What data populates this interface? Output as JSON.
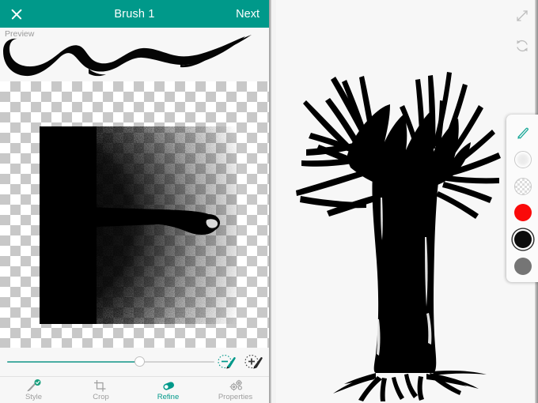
{
  "app": {
    "accent_color": "#00998a",
    "accent_light": "#4aada3"
  },
  "header": {
    "title": "Brush 1",
    "close_icon": "close-icon",
    "next_label": "Next"
  },
  "preview": {
    "label": "Preview",
    "stroke_color": "#000000"
  },
  "editor": {
    "canvas_background": "checkerboard",
    "bitmap_description": "dithered brush tip stamp"
  },
  "slider": {
    "value_percent": 64,
    "fill_color": "#4aada3",
    "track_color": "#d2d2d2"
  },
  "brush_tools": [
    {
      "name": "erase-brush-tool",
      "icon": "brush-minus-icon",
      "color": "#00998a",
      "selected": true
    },
    {
      "name": "add-brush-tool",
      "icon": "brush-plus-icon",
      "color": "#2b2b2b",
      "selected": false
    }
  ],
  "bottom_nav": {
    "items": [
      {
        "label": "Style",
        "icon": "brush-style-icon",
        "active": false
      },
      {
        "label": "Crop",
        "icon": "crop-icon",
        "active": false
      },
      {
        "label": "Refine",
        "icon": "refine-capsule-icon",
        "active": true
      },
      {
        "label": "Properties",
        "icon": "gears-icon",
        "active": false
      }
    ]
  },
  "canvas": {
    "background_color": "#f5f5f5",
    "artwork_title": "tree silhouette",
    "artwork_color": "#000000",
    "tools": [
      {
        "name": "expand-canvas-button",
        "icon": "expand-arrows-icon"
      },
      {
        "name": "reset-canvas-button",
        "icon": "refresh-icon"
      }
    ]
  },
  "palette": {
    "items": [
      {
        "name": "pencil-tool",
        "icon": "pencil-icon",
        "color": "#1aa898",
        "selected": false
      },
      {
        "name": "soft-swatch",
        "icon": "soft-circle-icon",
        "color": "#eeeeee",
        "selected": false
      },
      {
        "name": "transparent-swatch",
        "icon": "checker-circle-icon",
        "color": "transparent",
        "selected": false
      },
      {
        "name": "red-swatch",
        "icon": "color-circle-icon",
        "color": "#fa0a0a",
        "selected": false
      },
      {
        "name": "black-swatch",
        "icon": "color-circle-icon",
        "color": "#0d0d0d",
        "selected": true
      },
      {
        "name": "gray-swatch",
        "icon": "color-circle-icon",
        "color": "#757575",
        "selected": false
      }
    ]
  }
}
